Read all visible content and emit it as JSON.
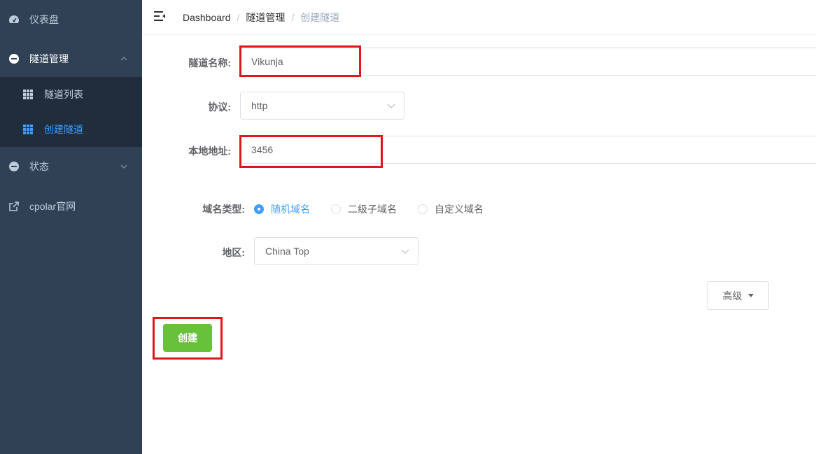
{
  "sidebar": {
    "items": [
      {
        "label": "仪表盘",
        "icon": "dashboard-icon"
      },
      {
        "label": "隧道管理",
        "icon": "tunnel-icon"
      },
      {
        "label": "状态",
        "icon": "status-icon"
      },
      {
        "label": "cpolar官网",
        "icon": "external-link-icon"
      }
    ],
    "submenu": [
      {
        "label": "隧道列表",
        "icon": "table-icon"
      },
      {
        "label": "创建隧道",
        "icon": "table-icon"
      }
    ],
    "active_color": "#409eff"
  },
  "header": {
    "breadcrumb": [
      "Dashboard",
      "隧道管理",
      "创建隧道"
    ]
  },
  "form": {
    "name_label": "隧道名称:",
    "name_value": "Vikunja",
    "protocol_label": "协议:",
    "protocol_value": "http",
    "local_label": "本地地址:",
    "local_value": "3456",
    "domain_type_label": "域名类型:",
    "domain_types": [
      "随机域名",
      "二级子域名",
      "自定义域名"
    ],
    "domain_type_selected": "随机域名",
    "region_label": "地区:",
    "region_value": "China Top",
    "advanced_label": "高级",
    "create_label": "创建"
  },
  "colors": {
    "sidebar_bg": "#304156",
    "highlight_red": "#e0161b",
    "create_green": "#67c23a"
  }
}
